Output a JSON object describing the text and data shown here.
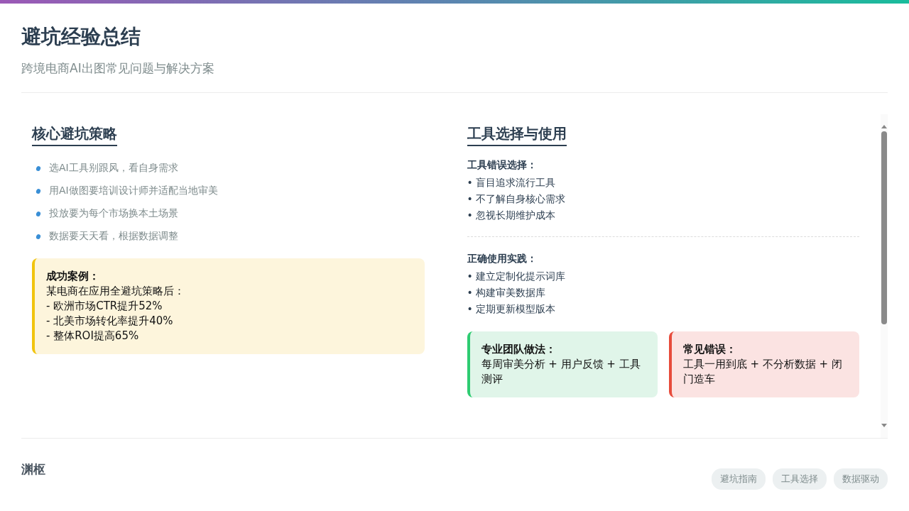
{
  "header": {
    "title": "避坑经验总结",
    "subtitle": "跨境电商AI出图常见问题与解决方案"
  },
  "left": {
    "heading": "核心避坑策略",
    "bullets": [
      "选AI工具别跟风，看自身需求",
      "用AI做图要培训设计师并适配当地审美",
      "投放要为每个市场换本土场景",
      "数据要天天看，根据数据调整"
    ],
    "callout": {
      "kind": "highlight",
      "title": "成功案例：",
      "lines": [
        "某电商在应用全避坑策略后：",
        "- 欧洲市场CTR提升52%",
        "- 北美市场转化率提升40%",
        "- 整体ROI提高65%"
      ]
    }
  },
  "right": {
    "heading": "工具选择与使用",
    "groups": [
      {
        "title": "工具错误选择：",
        "items": [
          "• 盲目追求流行工具",
          "• 不了解自身核心需求",
          "• 忽视长期维护成本"
        ]
      },
      {
        "title": "正确使用实践：",
        "items": [
          "• 建立定制化提示词库",
          "• 构建审美数据库",
          "• 定期更新模型版本"
        ]
      }
    ],
    "callouts": [
      {
        "kind": "good",
        "title": "专业团队做法：",
        "text": "每周审美分析 + 用户反馈 + 工具测评"
      },
      {
        "kind": "bad",
        "title": "常见错误：",
        "text": "工具一用到底 + 不分析数据 + 闭门造车"
      }
    ]
  },
  "footer": {
    "brand": "渊枢",
    "tags": [
      "避坑指南",
      "工具选择",
      "数据驱动"
    ]
  }
}
